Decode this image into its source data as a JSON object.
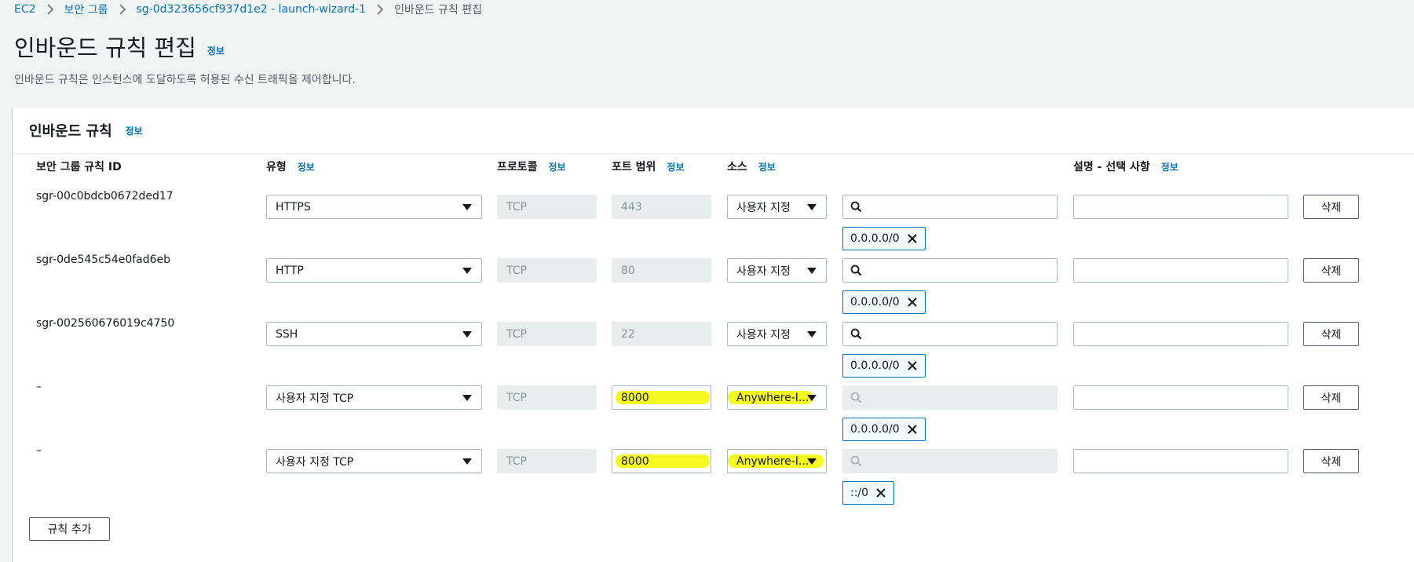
{
  "breadcrumb": {
    "items": [
      "EC2",
      "보안 그룹",
      "sg-0d323656cf937d1e2 - launch-wizard-1",
      "인바운드 규칙 편집"
    ]
  },
  "page": {
    "title": "인바운드 규칙 편집",
    "info": "정보",
    "description": "인바운드 규칙은 인스턴스에 도달하도록 허용된 수신 트래픽을 제어합니다."
  },
  "panel": {
    "title": "인바운드 규칙",
    "info": "정보",
    "add_rule_label": "규칙 추가"
  },
  "columns": {
    "rule_id": "보안 그룹 규칙 ID",
    "type": "유형",
    "protocol": "프로토콜",
    "port_range": "포트 범위",
    "source": "소스",
    "description": "설명 - 선택 사항",
    "info": "정보"
  },
  "rows": [
    {
      "rule_id": "sgr-00c0bdcb0672ded17",
      "type": "HTTPS",
      "protocol": "TCP",
      "port": "443",
      "source": "사용자 지정",
      "cidr": "0.0.0.0/0",
      "delete": "삭제"
    },
    {
      "rule_id": "sgr-0de545c54e0fad6eb",
      "type": "HTTP",
      "protocol": "TCP",
      "port": "80",
      "source": "사용자 지정",
      "cidr": "0.0.0.0/0",
      "delete": "삭제"
    },
    {
      "rule_id": "sgr-002560676019c4750",
      "type": "SSH",
      "protocol": "TCP",
      "port": "22",
      "source": "사용자 지정",
      "cidr": "0.0.0.0/0",
      "delete": "삭제"
    },
    {
      "rule_id": "–",
      "type": "사용자 지정 TCP",
      "protocol": "TCP",
      "port": "8000",
      "source": "Anywhere-I...",
      "cidr": "0.0.0.0/0",
      "delete": "삭제"
    },
    {
      "rule_id": "–",
      "type": "사용자 지정 TCP",
      "protocol": "TCP",
      "port": "8000",
      "source": "Anywhere-I...",
      "cidr": "::/0",
      "delete": "삭제"
    }
  ],
  "colors": {
    "link": "#0073bb",
    "highlight": "#f4f80c"
  }
}
